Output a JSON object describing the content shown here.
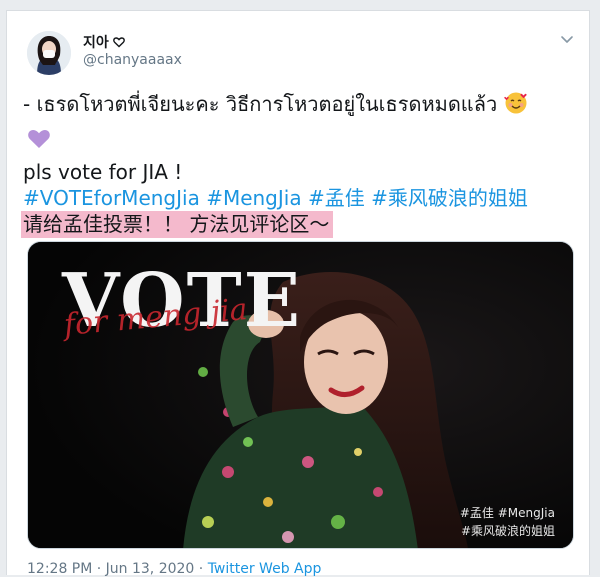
{
  "tweet": {
    "display_name": "지아",
    "handle": "@chanyaaaax",
    "line1": "- เธรดโหวตพี่เจียนะคะ วิธีการโหวตอยู่ในเธรดหมดแล้ว",
    "line2": "pls vote for JIA !",
    "hashtags": [
      "#VOTEforMengJia",
      "#MengJia",
      "#孟佳",
      "#乘风破浪的姐姐"
    ],
    "highlight_text": "请给孟佳投票！！ 方法见评论区～",
    "media": {
      "vote_text": "VOTE",
      "vote_sub": "for meng jia",
      "tag1": "#孟佳 #MengJia",
      "tag2": "#乘风破浪的姐姐"
    },
    "timestamp": "12:28 PM · Jun 13, 2020 · ",
    "source": "Twitter Web App"
  },
  "icons": {
    "heart": "white-heart-icon",
    "purple_heart": "purple-heart-icon",
    "smile": "smiling-face-with-hearts-icon",
    "chevron": "chevron-down-icon"
  },
  "colors": {
    "hashtag": "#1b95e0",
    "highlight": "#f4b9cc",
    "text": "#14171a",
    "secondary": "#657786"
  }
}
